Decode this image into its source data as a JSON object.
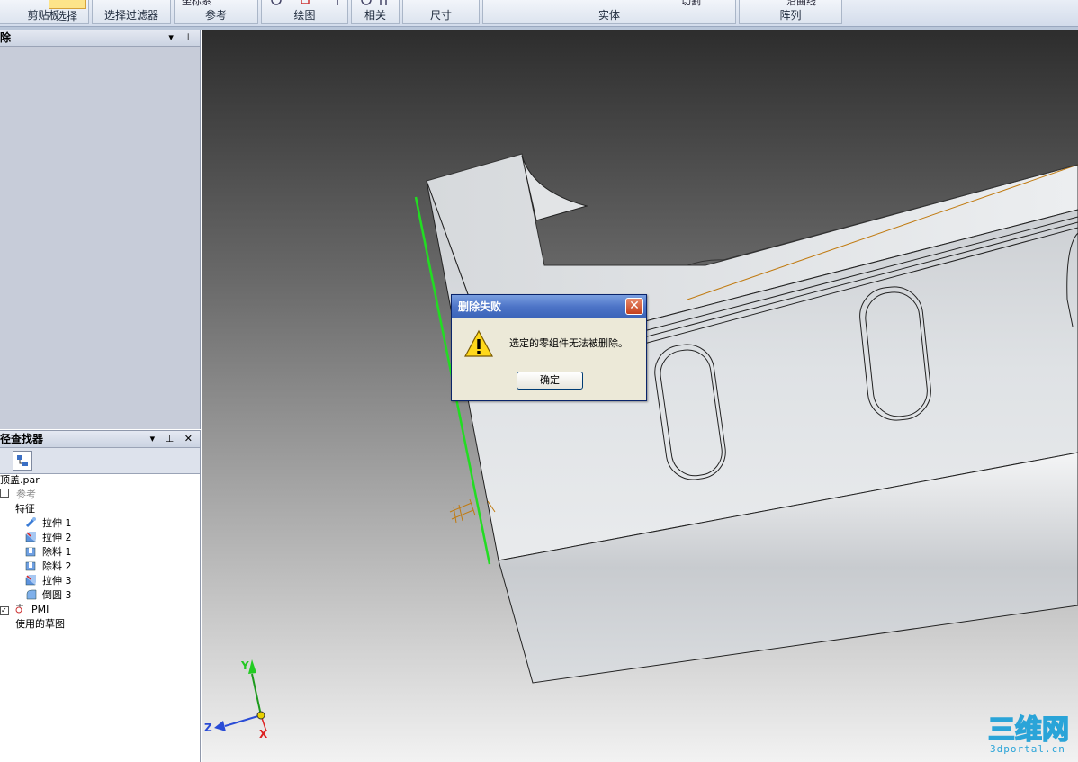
{
  "ribbon": {
    "groups": [
      {
        "label": "剪贴板"
      },
      {
        "label": "选择"
      },
      {
        "label": "选择过滤器"
      },
      {
        "label": "参考",
        "top": "坐标系"
      },
      {
        "label": "绘图"
      },
      {
        "label": "相关"
      },
      {
        "label": "尺寸"
      },
      {
        "label": "实体",
        "top": "切割"
      },
      {
        "label": "阵列",
        "top": "沿曲线"
      }
    ]
  },
  "left_top_pane": {
    "title": "除"
  },
  "pathfinder": {
    "title": "径查找器",
    "items": [
      {
        "label": "顶盖.par"
      },
      {
        "label": "参考"
      },
      {
        "label": "特征"
      },
      {
        "label": "拉伸 1"
      },
      {
        "label": "拉伸 2"
      },
      {
        "label": "除料 1"
      },
      {
        "label": "除料 2"
      },
      {
        "label": "拉伸 3"
      },
      {
        "label": "倒圆 3"
      },
      {
        "label": "PMI"
      },
      {
        "label": "使用的草图"
      }
    ]
  },
  "dialog": {
    "title": "删除失败",
    "message": "选定的零组件无法被删除。",
    "ok_label": "确定"
  },
  "axes": {
    "y": "Y",
    "z": "Z",
    "x": "X"
  },
  "watermark": {
    "text": "三维网",
    "sub": "3dportal.cn"
  }
}
